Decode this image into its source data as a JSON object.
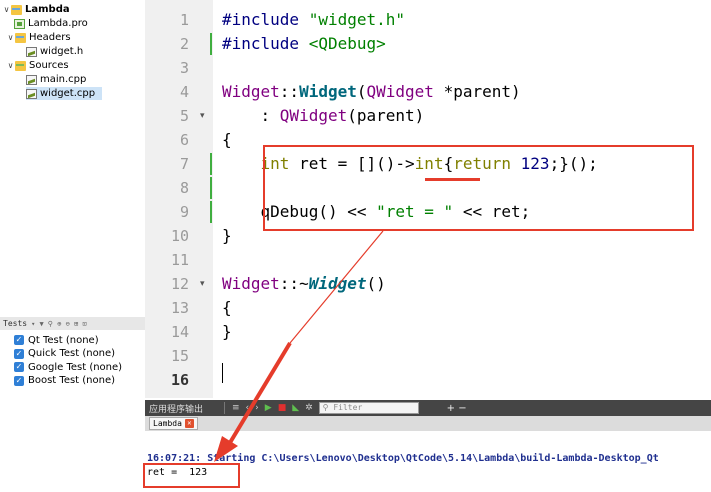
{
  "project_tree": [
    {
      "label": "Lambda",
      "kind": "project-root",
      "icon": "project-folder-icon",
      "bold": true,
      "expanded": true
    },
    {
      "label": "Lambda.pro",
      "kind": "pro-file",
      "icon": "pro-file-icon"
    },
    {
      "label": "Headers",
      "kind": "folder",
      "icon": "folder-icon",
      "expanded": true
    },
    {
      "label": "widget.h",
      "kind": "file",
      "icon": "header-file-icon"
    },
    {
      "label": "Sources",
      "kind": "folder",
      "icon": "folder-icon",
      "expanded": true
    },
    {
      "label": "main.cpp",
      "kind": "file",
      "icon": "source-file-icon"
    },
    {
      "label": "widget.cpp",
      "kind": "file",
      "icon": "source-file-icon",
      "selected": true
    }
  ],
  "tests": {
    "header": "Tests",
    "items": [
      {
        "label": "Qt Test (none)",
        "checked": true
      },
      {
        "label": "Quick Test (none)",
        "checked": true
      },
      {
        "label": "Google Test (none)",
        "checked": true
      },
      {
        "label": "Boost Test (none)",
        "checked": true
      }
    ]
  },
  "editor": {
    "line_numbers": [
      "1",
      "2",
      "3",
      "4",
      "5",
      "6",
      "7",
      "8",
      "9",
      "10",
      "11",
      "12",
      "13",
      "14",
      "15",
      "16"
    ],
    "current_line": "16",
    "code_lines": [
      [
        {
          "t": "#include ",
          "c": "pp"
        },
        {
          "t": "\"widget.h\"",
          "c": "str"
        }
      ],
      [
        {
          "t": "#include ",
          "c": "pp"
        },
        {
          "t": "<QDebug>",
          "c": "str"
        }
      ],
      [],
      [
        {
          "t": "Widget",
          "c": "cls"
        },
        {
          "t": "::",
          "c": "op"
        },
        {
          "t": "Widget",
          "c": "fn-bold"
        },
        {
          "t": "(",
          "c": "op"
        },
        {
          "t": "QWidget",
          "c": "cls"
        },
        {
          "t": " *parent)",
          "c": "op"
        }
      ],
      [
        {
          "t": "    : ",
          "c": "op"
        },
        {
          "t": "QWidget",
          "c": "cls"
        },
        {
          "t": "(parent)",
          "c": "op"
        }
      ],
      [
        {
          "t": "{",
          "c": "op"
        }
      ],
      [
        {
          "t": "    ",
          "c": "op"
        },
        {
          "t": "int",
          "c": "kw"
        },
        {
          "t": " ret = []()->",
          "c": "op"
        },
        {
          "t": "int",
          "c": "kw"
        },
        {
          "t": "{",
          "c": "op"
        },
        {
          "t": "return",
          "c": "kw"
        },
        {
          "t": " ",
          "c": "op"
        },
        {
          "t": "123",
          "c": "num"
        },
        {
          "t": ";}();",
          "c": "op"
        }
      ],
      [],
      [
        {
          "t": "    ",
          "c": "op"
        },
        {
          "t": "qDebug",
          "c": "fn"
        },
        {
          "t": "() << ",
          "c": "op"
        },
        {
          "t": "\"ret = \"",
          "c": "str"
        },
        {
          "t": " << ret;",
          "c": "op"
        }
      ],
      [
        {
          "t": "}",
          "c": "op"
        }
      ],
      [],
      [
        {
          "t": "Widget",
          "c": "cls"
        },
        {
          "t": "::~",
          "c": "op"
        },
        {
          "t": "Widget",
          "c": "fn-bi"
        },
        {
          "t": "()",
          "c": "op"
        }
      ],
      [
        {
          "t": "{",
          "c": "op"
        }
      ],
      [
        {
          "t": "}",
          "c": "op"
        }
      ],
      [],
      []
    ]
  },
  "output": {
    "title": "应用程序输出",
    "filter_placeholder": "Filter",
    "plus_minus": "+ −",
    "tab_label": "Lambda",
    "lines": [
      "16:07:21: Starting C:\\Users\\Lenovo\\Desktop\\QtCode\\5.14\\Lambda\\build-Lambda-Desktop_Qt",
      "ret =  123"
    ]
  },
  "colors": {
    "annotation": "#e53c2b",
    "keyword": "#808000",
    "string": "#008000",
    "class": "#800080",
    "function": "#00677c"
  }
}
